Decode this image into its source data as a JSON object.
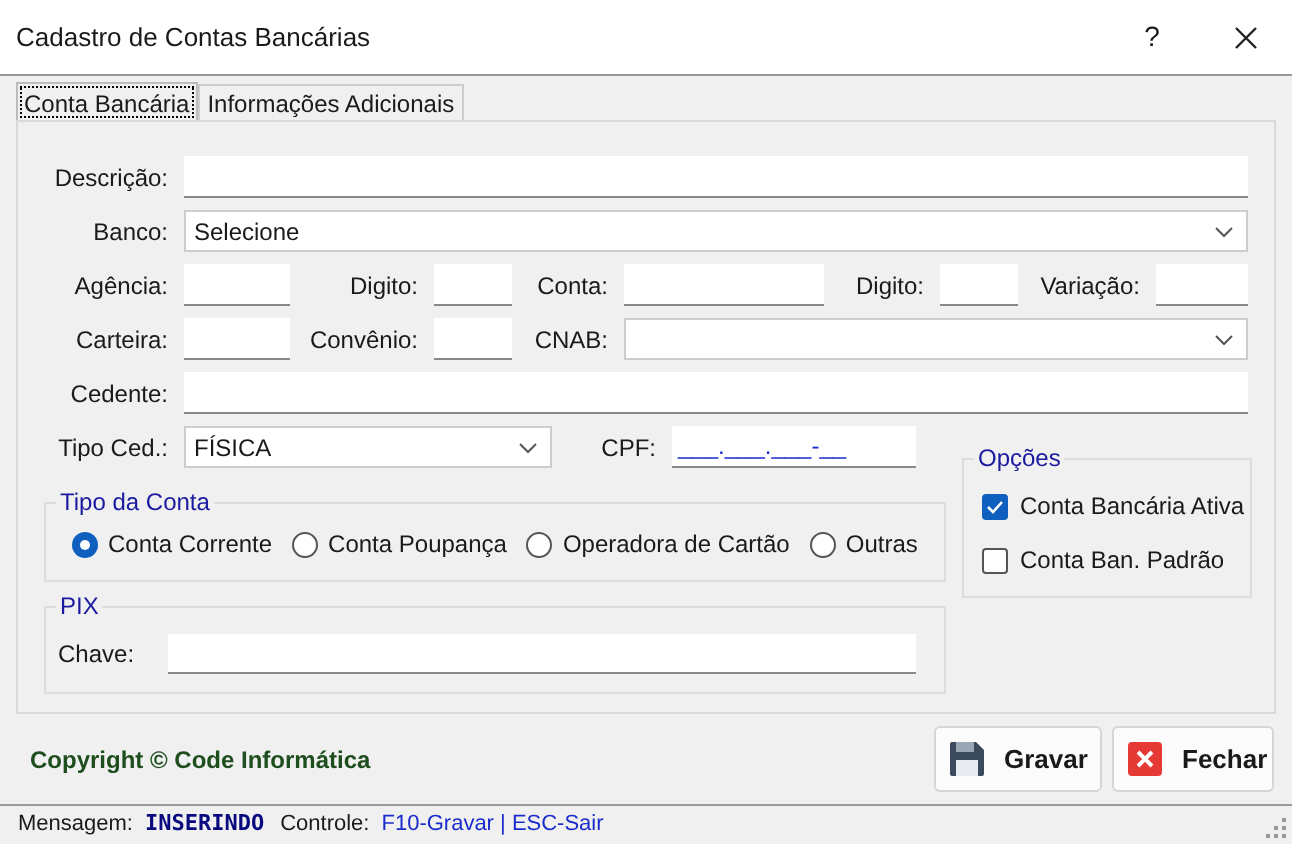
{
  "window": {
    "title": "Cadastro de Contas Bancárias",
    "help": "?"
  },
  "tabs": [
    {
      "label": "Conta Bancária",
      "selected": true
    },
    {
      "label": "Informações Adicionais",
      "selected": false
    }
  ],
  "form_rows": [
    [
      {
        "kind": "text",
        "label": "Descrição:"
      }
    ],
    [
      {
        "kind": "select",
        "label": "Banco:",
        "value": "Selecione"
      }
    ],
    [
      {
        "kind": "text",
        "label": "Agência:"
      },
      {
        "kind": "text",
        "label": "Digito:"
      },
      {
        "kind": "text",
        "label": "Conta:"
      },
      {
        "kind": "text",
        "label": "Digito:"
      },
      {
        "kind": "text",
        "label": "Variação:"
      }
    ],
    [
      {
        "kind": "text",
        "label": "Carteira:"
      },
      {
        "kind": "text",
        "label": "Convênio:"
      },
      {
        "kind": "select",
        "label": "CNAB:"
      }
    ],
    [
      {
        "kind": "text",
        "label": "Cedente:"
      }
    ],
    [
      {
        "kind": "select",
        "label": "Tipo Ced.:",
        "value": "FÍSICA"
      },
      {
        "kind": "mask",
        "label": "CPF:",
        "value": "___.___.___-__"
      }
    ]
  ],
  "tipo_da_conta": {
    "title": "Tipo da Conta",
    "options": [
      {
        "label": "Conta Corrente",
        "selected": true
      },
      {
        "label": "Conta Poupança",
        "selected": false
      },
      {
        "label": "Operadora de Cartão",
        "selected": false
      },
      {
        "label": "Outras",
        "selected": false
      }
    ]
  },
  "opcoes": {
    "title": "Opções",
    "options": [
      {
        "label": "Conta Bancária Ativa",
        "checked": true
      },
      {
        "label": "Conta Ban. Padrão",
        "checked": false
      }
    ]
  },
  "pix": {
    "title": "PIX",
    "label": "Chave:"
  },
  "footer": {
    "copyright": "Copyright © Code Informática",
    "buttons": [
      {
        "kind": "save",
        "label": "Gravar"
      },
      {
        "kind": "close",
        "label": "Fechar"
      }
    ]
  },
  "status_bar": {
    "message_label": "Mensagem:",
    "message": "INSERINDO",
    "control_label": "Controle:",
    "control": "F10-Gravar | ESC-Sair"
  }
}
